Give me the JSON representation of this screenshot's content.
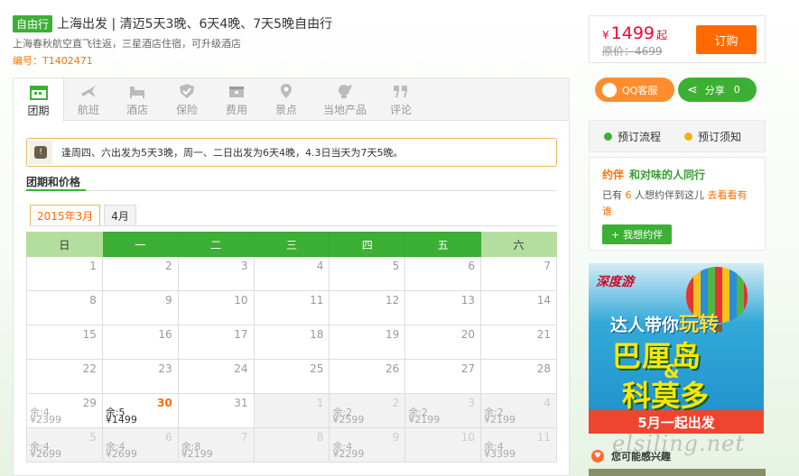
{
  "header": {
    "badge": "自由行",
    "title": "上海出发 | 清迈5天3晚、6天4晚、7天5晚自由行",
    "subtitle": "上海春秋航空直飞往返，三星酒店住宿，可升级酒店",
    "code": "编号：T1402471"
  },
  "price": {
    "currency": "¥",
    "amount": "1499",
    "suffix": "起",
    "original": "原价：4699",
    "buy_label": "订购"
  },
  "social": {
    "qq_label": "QQ客服",
    "share_label": "分享",
    "share_count": "0"
  },
  "process": {
    "flow_label": "预订流程",
    "notice_label": "预订须知"
  },
  "yue": {
    "logo": "约伴",
    "title": "和对味的人同行",
    "text_pre": "已有",
    "count": "6",
    "text_post": "人想约伴到这儿",
    "link": "去看看有谁",
    "button": "我想约伴"
  },
  "ad": {
    "brand": "深度游",
    "line1_a": "达人带你",
    "line1_b": "玩转",
    "line2": "巴厘岛",
    "amp": "&",
    "line3": "科莫多",
    "bar": "5月一起出发"
  },
  "interest_label": "您可能感兴趣",
  "watermark": "elsiling.net",
  "tabs": [
    {
      "label": "团期",
      "icon": "calendar-icon"
    },
    {
      "label": "航班",
      "icon": "plane-icon"
    },
    {
      "label": "酒店",
      "icon": "bed-icon"
    },
    {
      "label": "保险",
      "icon": "shield-icon"
    },
    {
      "label": "费用",
      "icon": "wallet-icon"
    },
    {
      "label": "景点",
      "icon": "pin-icon"
    },
    {
      "label": "当地产品",
      "icon": "gift-icon"
    },
    {
      "label": "评论",
      "icon": "quote-icon"
    }
  ],
  "notice": "逢周四、六出发为5天3晚，周一、二日出发为6天4晚，4.3日当天为7天5晚。",
  "section_title": "团期和价格",
  "month_tabs": [
    "2015年3月",
    "4月"
  ],
  "weekdays": [
    "日",
    "一",
    "二",
    "三",
    "四",
    "五",
    "六"
  ],
  "weeks": [
    [
      {
        "d": "1"
      },
      {
        "d": "2"
      },
      {
        "d": "3"
      },
      {
        "d": "4"
      },
      {
        "d": "5"
      },
      {
        "d": "6"
      },
      {
        "d": "7"
      }
    ],
    [
      {
        "d": "8"
      },
      {
        "d": "9"
      },
      {
        "d": "10"
      },
      {
        "d": "11"
      },
      {
        "d": "12"
      },
      {
        "d": "13"
      },
      {
        "d": "14"
      }
    ],
    [
      {
        "d": "15"
      },
      {
        "d": "16"
      },
      {
        "d": "17"
      },
      {
        "d": "18"
      },
      {
        "d": "19"
      },
      {
        "d": "20"
      },
      {
        "d": "21"
      }
    ],
    [
      {
        "d": "22"
      },
      {
        "d": "23"
      },
      {
        "d": "24"
      },
      {
        "d": "25"
      },
      {
        "d": "26"
      },
      {
        "d": "27"
      },
      {
        "d": "28"
      }
    ],
    [
      {
        "d": "29",
        "rem": "余:4",
        "pr": "¥2399",
        "strike": true
      },
      {
        "d": "30",
        "rem": "余:5",
        "pr": "¥1499",
        "today": true
      },
      {
        "d": "31"
      },
      {
        "d": "1",
        "dim": true
      },
      {
        "d": "2",
        "dim": true,
        "rem": "余:2",
        "pr": "¥2599"
      },
      {
        "d": "3",
        "dim": true,
        "rem": "余:2",
        "pr": "¥2199"
      },
      {
        "d": "4",
        "dim": true,
        "rem": "余:2",
        "pr": "¥2199"
      }
    ],
    [
      {
        "d": "5",
        "dim": true,
        "rem": "余:4",
        "pr": "¥2699"
      },
      {
        "d": "6",
        "dim": true,
        "rem": "余:4",
        "pr": "¥2699"
      },
      {
        "d": "7",
        "dim": true,
        "rem": "余:8",
        "pr": "¥2199"
      },
      {
        "d": "8",
        "dim": true
      },
      {
        "d": "9",
        "dim": true,
        "rem": "余:4",
        "pr": "¥2299"
      },
      {
        "d": "10",
        "dim": true
      },
      {
        "d": "11",
        "dim": true,
        "rem": "余:4",
        "pr": "¥3399"
      }
    ]
  ]
}
